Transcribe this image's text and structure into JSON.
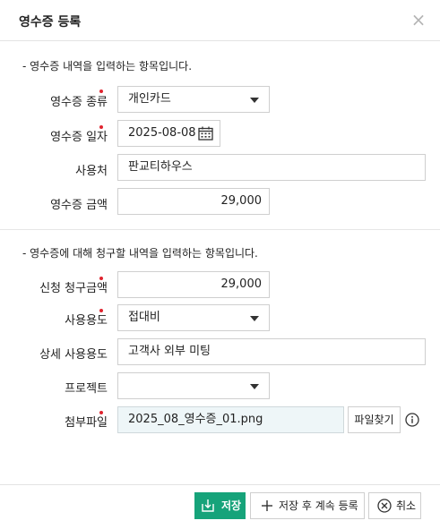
{
  "dialog": {
    "title": "영수증 등록",
    "close_label": "×"
  },
  "section1": {
    "note": "- 영수증 내역을 입력하는 항목입니다.",
    "receipt_type": {
      "label": "영수증 종류",
      "required": true,
      "value": "개인카드"
    },
    "receipt_date": {
      "label": "영수증 일자",
      "required": true,
      "value": "2025-08-08"
    },
    "merchant": {
      "label": "사용처",
      "required": false,
      "value": "판교티하우스"
    },
    "amount": {
      "label": "영수증 금액",
      "required": false,
      "value": "29,000"
    }
  },
  "section2": {
    "note": "- 영수증에 대해 청구할 내역을 입력하는 항목입니다.",
    "claim_amount": {
      "label": "신청 청구금액",
      "required": true,
      "value": "29,000"
    },
    "usage": {
      "label": "사용용도",
      "required": true,
      "value": "접대비"
    },
    "usage_detail": {
      "label": "상세 사용용도",
      "required": false,
      "value": "고객사 외부 미팅"
    },
    "project": {
      "label": "프로젝트",
      "required": false,
      "value": ""
    },
    "attachment": {
      "label": "첨부파일",
      "required": true,
      "value": "2025_08_영수증_01.png",
      "button_label": "파일찾기"
    }
  },
  "footer": {
    "save_label": "저장",
    "save_continue_label": "저장 후 계속 등록",
    "cancel_label": "취소"
  },
  "colors": {
    "primary": "#16a37a",
    "required": "#e0242f",
    "file_bg": "#eef6f8"
  }
}
